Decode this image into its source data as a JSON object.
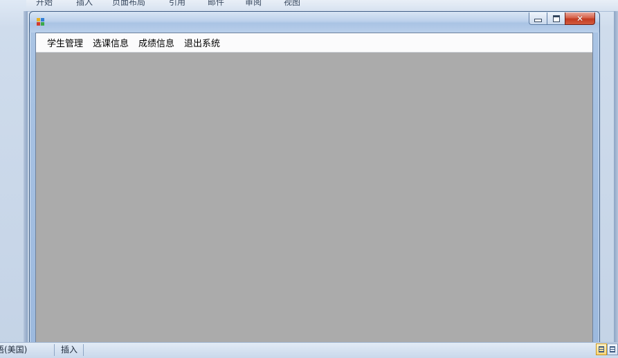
{
  "host_app": {
    "ribbon_tabs": [
      "开始",
      "插入",
      "页面布局",
      "引用",
      "邮件",
      "审阅",
      "视图"
    ],
    "status": {
      "language": "英语(美国)",
      "mode": "插入"
    }
  },
  "window": {
    "title": "",
    "controls": {
      "minimize": "minimize",
      "maximize": "maximize",
      "close": "close"
    }
  },
  "menu": {
    "items": [
      {
        "label": "学生管理"
      },
      {
        "label": "选课信息"
      },
      {
        "label": "成绩信息"
      },
      {
        "label": "退出系统"
      }
    ]
  },
  "colors": {
    "mdi_background": "#ababab",
    "menubar_background": "#fbfbfc",
    "close_button": "#c33b21"
  }
}
